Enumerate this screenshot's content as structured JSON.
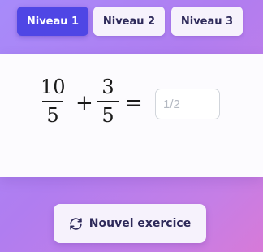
{
  "levels": [
    {
      "label": "Niveau 1",
      "active": true
    },
    {
      "label": "Niveau 2",
      "active": false
    },
    {
      "label": "Niveau 3",
      "active": false
    }
  ],
  "exercise": {
    "term1": {
      "numerator": "10",
      "denominator": "5"
    },
    "operator": "+",
    "term2": {
      "numerator": "3",
      "denominator": "5"
    },
    "equals": "=",
    "answer_value": "",
    "answer_placeholder": "1/2"
  },
  "actions": {
    "new_exercise_label": "Nouvel exercice",
    "new_exercise_icon": "refresh-icon"
  },
  "colors": {
    "accent": "#4f46e5",
    "background_start": "#a78bfa",
    "background_end": "#d77ad8",
    "card": "#fcfbfe",
    "button_text": "#2e2a5a"
  }
}
